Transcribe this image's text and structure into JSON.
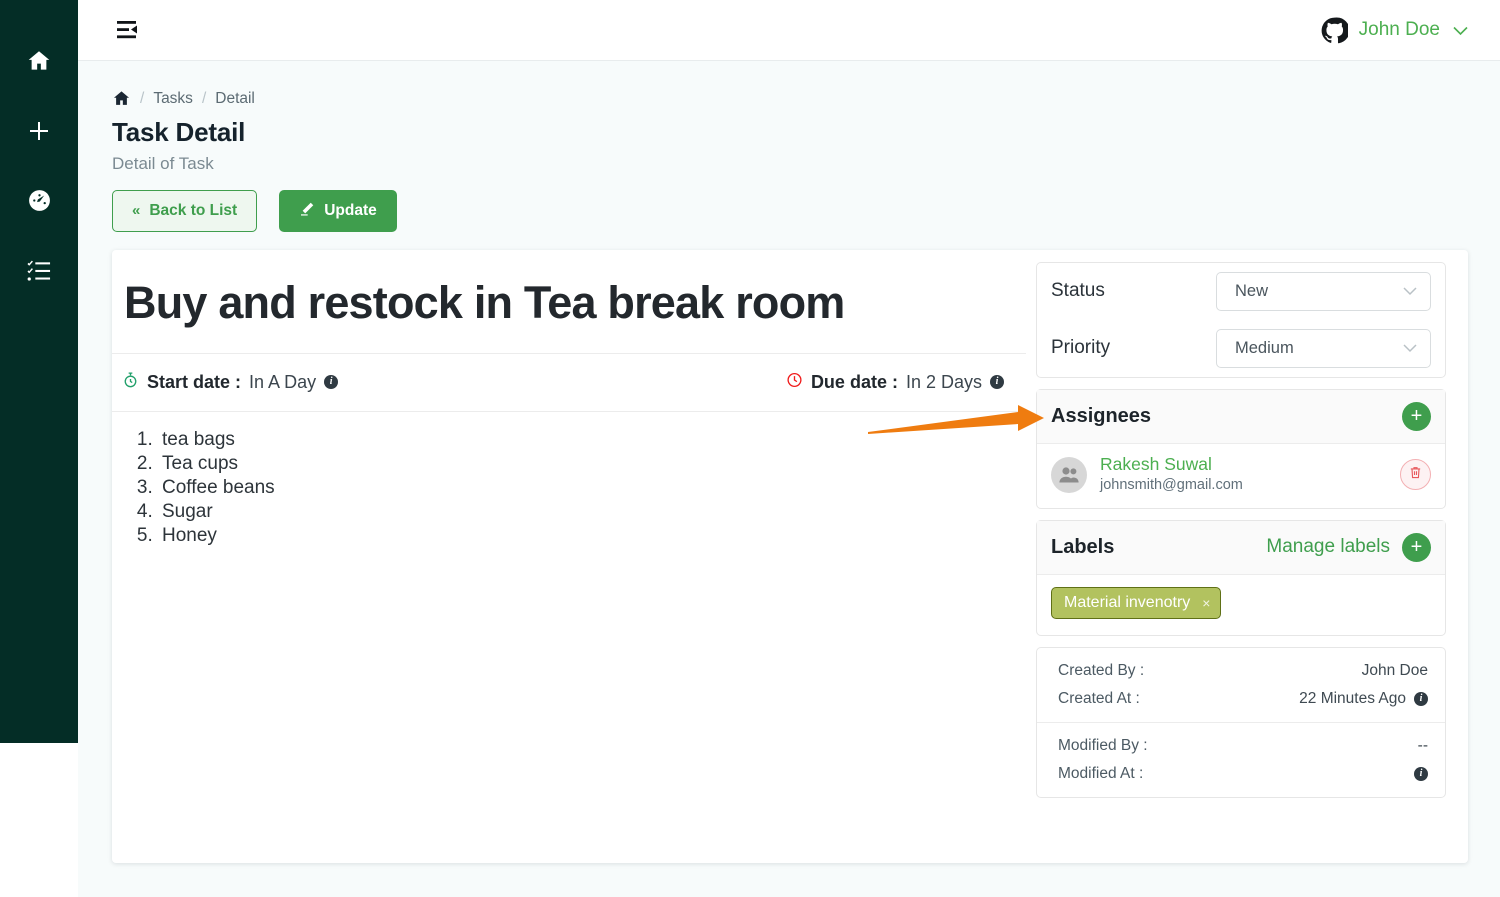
{
  "sidebar": {
    "items": [
      {
        "name": "home",
        "icon": "home-icon"
      },
      {
        "name": "add",
        "icon": "plus-icon"
      },
      {
        "name": "dashboard",
        "icon": "speedometer-icon"
      },
      {
        "name": "tasks",
        "icon": "checklist-icon"
      }
    ]
  },
  "topbar": {
    "fold_icon": "menu-fold-icon",
    "brand_icon": "github-icon",
    "user_name": "John Doe",
    "chevron": "⌄"
  },
  "breadcrumb": {
    "home_icon": "home-icon",
    "separator": "/",
    "items": [
      "Tasks",
      "Detail"
    ]
  },
  "header": {
    "title": "Task Detail",
    "subtitle": "Detail of Task",
    "back_button": "Back to List",
    "back_icon": "«",
    "update_button": "Update",
    "update_icon": "pencil-icon"
  },
  "task": {
    "title": "Buy and restock in Tea break room",
    "start_date_label": "Start date :",
    "start_date_value": "In A Day",
    "start_date_icon": "stopwatch-icon",
    "due_date_label": "Due date :",
    "due_date_value": "In 2 Days",
    "due_date_icon": "clock-icon",
    "info_icon": "info-icon",
    "description_items": [
      "tea bags",
      "Tea cups",
      "Coffee beans",
      "Sugar",
      "Honey"
    ]
  },
  "properties": {
    "status_label": "Status",
    "status_value": "New",
    "priority_label": "Priority",
    "priority_value": "Medium",
    "chevron_icon": "chevron-down-icon"
  },
  "assignees": {
    "title": "Assignees",
    "add_icon": "plus-icon",
    "add_label": "+",
    "list": [
      {
        "name": "Rakesh Suwal",
        "email": "johnsmith@gmail.com",
        "avatar_icon": "users-avatar-icon",
        "delete_icon": "trash-icon"
      }
    ]
  },
  "labels": {
    "title": "Labels",
    "manage_link": "Manage labels",
    "add_label": "+",
    "chips": [
      {
        "text": "Material invenotry",
        "remove": "×"
      }
    ]
  },
  "metadata": {
    "rows": [
      {
        "key": "Created By :",
        "value": "John Doe",
        "info": false
      },
      {
        "key": "Created At :",
        "value": "22 Minutes Ago",
        "info": true
      },
      {
        "key": "Modified By :",
        "value": "--",
        "info": false
      },
      {
        "key": "Modified At :",
        "value": "",
        "info": true
      }
    ]
  },
  "annotation": {
    "type": "arrow",
    "color": "#ef7c10",
    "points_to": "Priority"
  },
  "colors": {
    "sidebar_bg": "#042d26",
    "accent_green": "#3f9e4d",
    "link_green": "#4caf50",
    "page_bg": "#f7fbfb",
    "chip_bg": "#b2c25f",
    "danger": "#e8595d",
    "annotation_orange": "#ef7c10"
  }
}
